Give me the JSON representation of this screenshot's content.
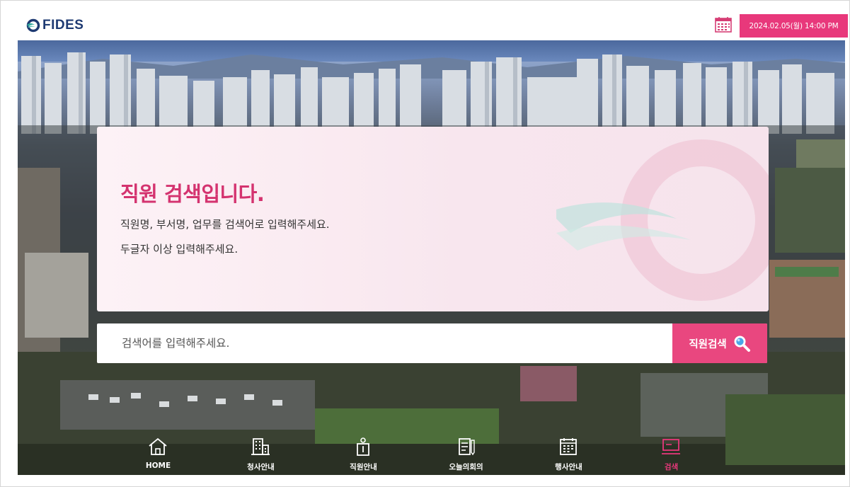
{
  "header": {
    "logo_text": "FIDES",
    "datetime": "2024.02.05(월) 14:00 PM",
    "calendar_icon": "calendar-icon",
    "accent_color": "#e8387b"
  },
  "card": {
    "title": "직원 검색입니다.",
    "line1": "직원명, 부서명, 업무를 검색어로 입력해주세요.",
    "line2": "두글자 이상 입력해주세요."
  },
  "search": {
    "placeholder": "검색어를 입력해주세요.",
    "value": "",
    "button_label": "직원검색",
    "button_icon": "search-icon"
  },
  "nav": {
    "items": [
      {
        "label": "HOME",
        "icon": "home-icon",
        "active": false
      },
      {
        "label": "청사안내",
        "icon": "building-icon",
        "active": false
      },
      {
        "label": "직원안내",
        "icon": "staff-icon",
        "active": false
      },
      {
        "label": "오늘의회의",
        "icon": "meeting-icon",
        "active": false
      },
      {
        "label": "행사안내",
        "icon": "calendar-icon",
        "active": false
      },
      {
        "label": "검색",
        "icon": "search-screen-icon",
        "active": true
      }
    ]
  }
}
